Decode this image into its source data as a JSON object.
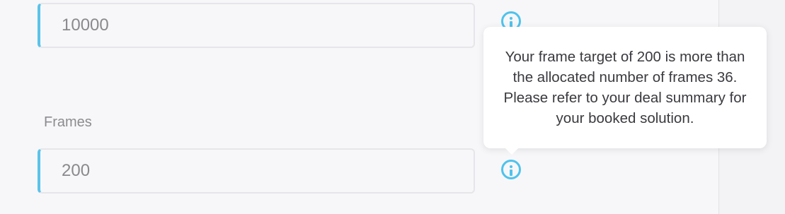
{
  "impressions_field": {
    "value": "10000"
  },
  "frames_field": {
    "label": "Frames",
    "value": "200"
  },
  "tooltip": {
    "text": "Your frame target of 200 is more than the allocated number of frames 36. Please refer to your deal summary for your booked solution."
  },
  "icons": {
    "info": "info-circle-icon"
  },
  "colors": {
    "accent": "#4fc3ec",
    "input_border_accent": "#5bc3ea",
    "background": "#f7f7f9",
    "text_muted": "#8a8a8e"
  }
}
